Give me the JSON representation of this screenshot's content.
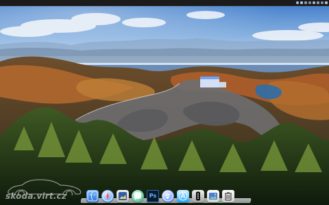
{
  "watermark": {
    "text": "skoda.virt.cz"
  },
  "menubar": {
    "tray_icons": [
      "wifi-icon",
      "volume-icon",
      "battery-icon",
      "bluetooth-icon",
      "spotlight-icon",
      "user-icon",
      "time-machine-icon",
      "dropbox-icon"
    ]
  },
  "dock": {
    "icons": [
      {
        "name": "finder-icon"
      },
      {
        "name": "safari-icon"
      },
      {
        "name": "preview-icon"
      },
      {
        "name": "ichat-icon"
      },
      {
        "name": "photoshop-icon",
        "label": "Ps"
      },
      {
        "name": "itunes-icon"
      },
      {
        "name": "app-store-icon"
      },
      {
        "name": "itunes-remote-icon"
      },
      {
        "name": "photo-icon"
      },
      {
        "name": "trash-icon"
      }
    ]
  }
}
